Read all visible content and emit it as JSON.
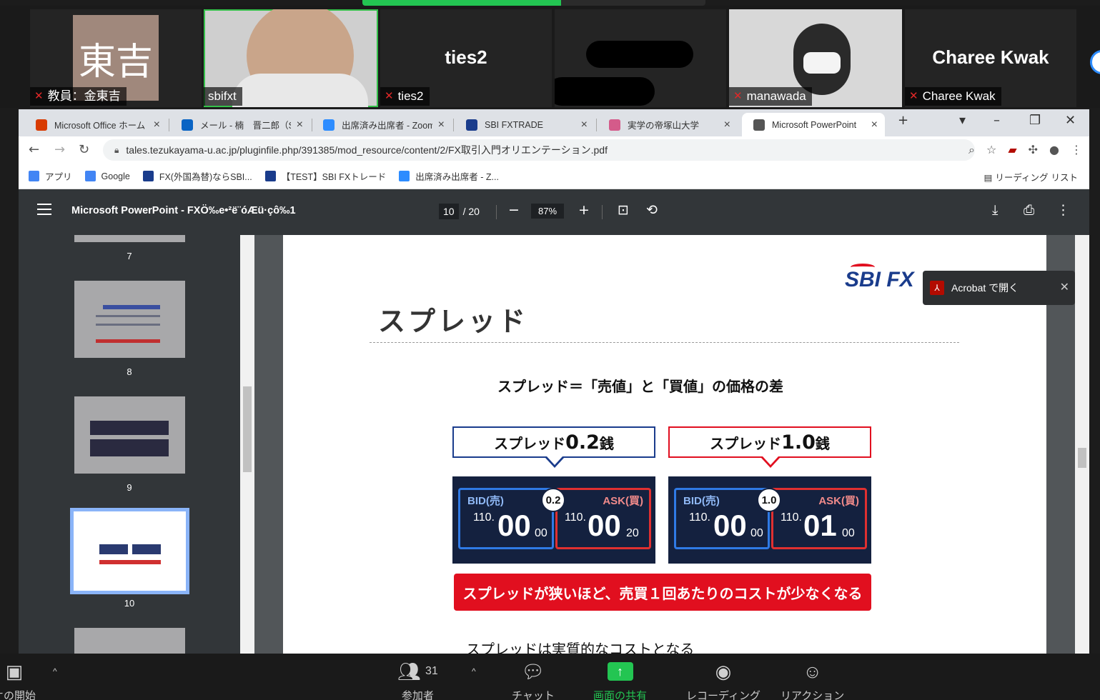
{
  "zoom": {
    "top_progress_pct": 58,
    "participants": [
      {
        "name": "教員：金東吉",
        "avatar_text": "東吉",
        "muted": true
      },
      {
        "name": "sbifxt",
        "muted": false,
        "active_speaker": true
      },
      {
        "name": "ties2",
        "display_name": "ties2",
        "muted": true
      },
      {
        "name": "",
        "muted": false
      },
      {
        "name": "manawada",
        "muted": true
      },
      {
        "name": "Charee Kwak",
        "display_name": "Charee Kwak",
        "muted": true
      }
    ],
    "bottom": {
      "video_label": "オの開始",
      "participants_count": "31",
      "participants_label": "参加者",
      "chat_label": "チャット",
      "share_label": "画面の共有",
      "record_label": "レコーディング",
      "reactions_label": "リアクション"
    }
  },
  "browser": {
    "tabs": [
      {
        "label": "Microsoft Office ホーム",
        "icon": "office-icon",
        "color": "#d83b01"
      },
      {
        "label": "メール - 楠　晋二郎（SI",
        "icon": "outlook-icon",
        "color": "#0a64c4"
      },
      {
        "label": "出席済み出席者 - Zoom",
        "icon": "zoom-icon",
        "color": "#2d8cff"
      },
      {
        "label": "SBI FXTRADE",
        "icon": "sbi-icon",
        "color": "#1a3c8c"
      },
      {
        "label": "実学の帝塚山大学",
        "icon": "flower-icon",
        "color": "#d45b8a"
      },
      {
        "label": "Microsoft PowerPoint",
        "icon": "globe-icon",
        "color": "#555555"
      }
    ],
    "url": "tales.tezukayama-u.ac.jp/pluginfile.php/391385/mod_resource/content/2/FX取引入門オリエンテーション.pdf",
    "bookmarks": [
      {
        "label": "アプリ",
        "icon": "apps-icon",
        "color": "#4285f4"
      },
      {
        "label": "Google",
        "icon": "google-icon",
        "color": "#4285f4"
      },
      {
        "label": "FX(外国為替)ならSBI...",
        "icon": "sbi-icon",
        "color": "#1a3c8c"
      },
      {
        "label": "【TEST】SBI FXトレード",
        "icon": "sbi-icon",
        "color": "#1a3c8c"
      },
      {
        "label": "出席済み出席者 - Z...",
        "icon": "zoom-icon",
        "color": "#2d8cff"
      }
    ],
    "reading_list": "リーディング リスト"
  },
  "pdf": {
    "title": "Microsoft PowerPoint - FXÖ‰e•²ë¨óÆü·çô‰1",
    "current_page": "10",
    "total_pages": "/ 20",
    "zoom": "87%",
    "thumbnails": [
      "7",
      "8",
      "9",
      "10"
    ],
    "acrobat_label": "Acrobat で開く"
  },
  "slide": {
    "logo_text": "SBI FX",
    "title": "スプレッド",
    "subtitle": "スプレッド＝「売値」と「買値」の価格の差",
    "examples": [
      {
        "label_prefix": "スプレッド",
        "label_value": "0.2",
        "label_unit": "銭",
        "color": "#1a3c8c",
        "spread": "0.2",
        "bid_label": "BID(売)",
        "ask_label": "ASK(買)",
        "bid_base": "110.",
        "bid_pips": "00",
        "bid_sub": "00",
        "ask_base": "110.",
        "ask_pips": "00",
        "ask_sub": "20"
      },
      {
        "label_prefix": "スプレッド",
        "label_value": "1.0",
        "label_unit": "銭",
        "color": "#e10f1f",
        "spread": "1.0",
        "bid_label": "BID(売)",
        "ask_label": "ASK(買)",
        "bid_base": "110.",
        "bid_pips": "00",
        "bid_sub": "00",
        "ask_base": "110.",
        "ask_pips": "01",
        "ask_sub": "00"
      }
    ],
    "banner": "スプレッドが狭いほど、売買１回あたりのコストが少なくなる",
    "footer": "スプレッドは実質的なコストとなる"
  }
}
